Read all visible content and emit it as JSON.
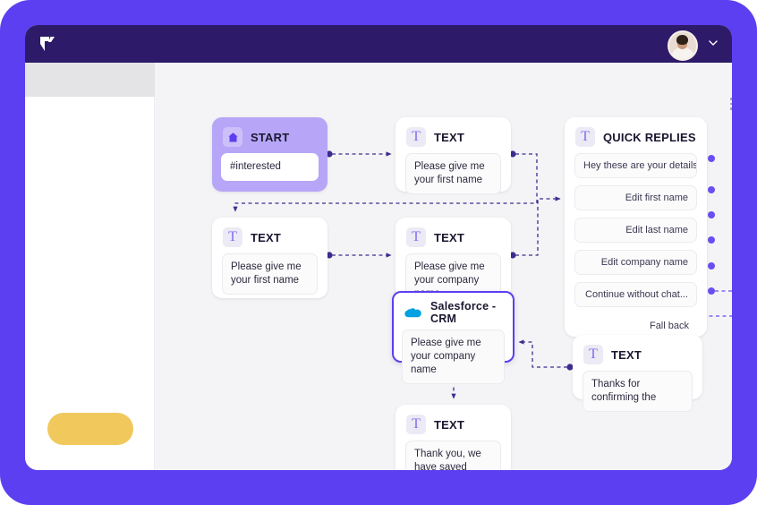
{
  "theme": {
    "frame_color": "#5c3ff0",
    "topbar_color": "#2d1b69",
    "canvas_color": "#f4f4f6",
    "accent_color": "#6b4ef2",
    "start_node_color": "#b7a6f7",
    "cta_color": "#f0c85c",
    "salesforce_logo_color": "#00a1e0"
  },
  "topbar": {
    "logo_name": "verloop-logo",
    "avatar_name": "user-avatar",
    "chevron_label": "account-menu"
  },
  "sidebar": {
    "cta_label": ""
  },
  "canvas": {
    "menu_label": "canvas-options"
  },
  "nodes": {
    "start": {
      "icon": "home-icon",
      "title": "START",
      "field": "#interested"
    },
    "text_first_name_1": {
      "icon": "text-icon",
      "title": "TEXT",
      "field": "Please give me your first name"
    },
    "text_first_name_2": {
      "icon": "text-icon",
      "title": "TEXT",
      "field": "Please give me your first name"
    },
    "text_company_name": {
      "icon": "text-icon",
      "title": "TEXT",
      "field": "Please give me your company name"
    },
    "quick_replies": {
      "icon": "text-icon",
      "title": "QUICK REPLIES",
      "options": [
        "Hey these are your details....",
        "Edit first name",
        "Edit last name",
        "Edit company name",
        "Continue without chat...",
        "Fall back"
      ]
    },
    "salesforce": {
      "icon": "salesforce-cloud-icon",
      "title": "Salesforce - CRM",
      "field": "Please give me your company name"
    },
    "text_thanks": {
      "icon": "text-icon",
      "title": "TEXT",
      "field": "Thanks for confirming the"
    },
    "text_saved": {
      "icon": "text-icon",
      "title": "TEXT",
      "field": "Thank you, we have saved your...."
    }
  }
}
